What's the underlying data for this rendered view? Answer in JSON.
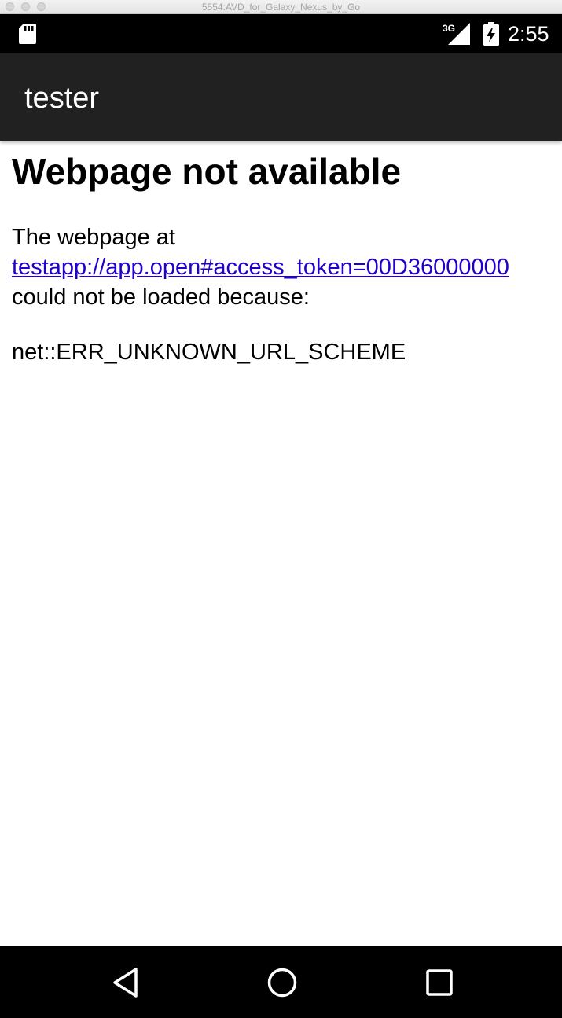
{
  "window": {
    "title": "5554:AVD_for_Galaxy_Nexus_by_Go"
  },
  "status_bar": {
    "network_type": "3G",
    "time": "2:55",
    "icons": [
      "sd-card-icon",
      "signal-icon",
      "battery-charging-icon"
    ]
  },
  "app_bar": {
    "title": "tester"
  },
  "error_page": {
    "heading": "Webpage not available",
    "intro": "The webpage at",
    "url": "testapp://app.open#access_token=00D36000000",
    "reason": "could not be loaded because:",
    "error_code": "net::ERR_UNKNOWN_URL_SCHEME"
  },
  "nav_bar": {
    "buttons": [
      "back-icon",
      "home-icon",
      "recents-icon"
    ]
  },
  "colors": {
    "status_bar": "#000000",
    "action_bar": "#212121",
    "link": "#2200cc",
    "nav_bar": "#000000"
  }
}
